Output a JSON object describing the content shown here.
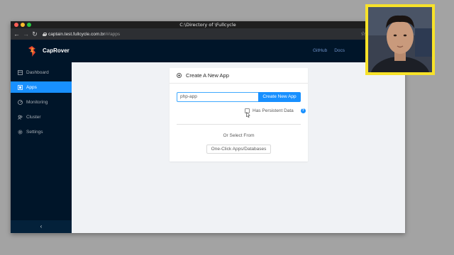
{
  "window": {
    "title": "C:\\Directory of \\Fullcycle"
  },
  "browser": {
    "url_host": "captain.test.fullcycle.com.br",
    "url_path": "/#/apps",
    "back_icon": "arrow-left-icon",
    "forward_icon": "arrow-right-icon",
    "reload_icon": "reload-icon"
  },
  "topnav": {
    "brand": "CapRover",
    "links": [
      "GitHub",
      "Docs"
    ]
  },
  "sidebar": {
    "items": [
      {
        "label": "Dashboard",
        "icon": "dashboard-icon",
        "active": false
      },
      {
        "label": "Apps",
        "icon": "apps-icon",
        "active": true
      },
      {
        "label": "Monitoring",
        "icon": "monitoring-icon",
        "active": false
      },
      {
        "label": "Cluster",
        "icon": "cluster-icon",
        "active": false
      },
      {
        "label": "Settings",
        "icon": "settings-icon",
        "active": false
      }
    ],
    "collapse_glyph": "‹"
  },
  "create_app": {
    "title": "Create A New App",
    "input_value": "php-app",
    "button_label": "Create New App",
    "persistent_label": "Has Persistent Data",
    "persistent_checked": false,
    "help_glyph": "?",
    "or_select": "Or Select From",
    "oneclick_label": "One-Click Apps/Databases"
  },
  "colors": {
    "nav_bg": "#001529",
    "accent": "#1890ff",
    "webcam_border": "#f7e229"
  }
}
